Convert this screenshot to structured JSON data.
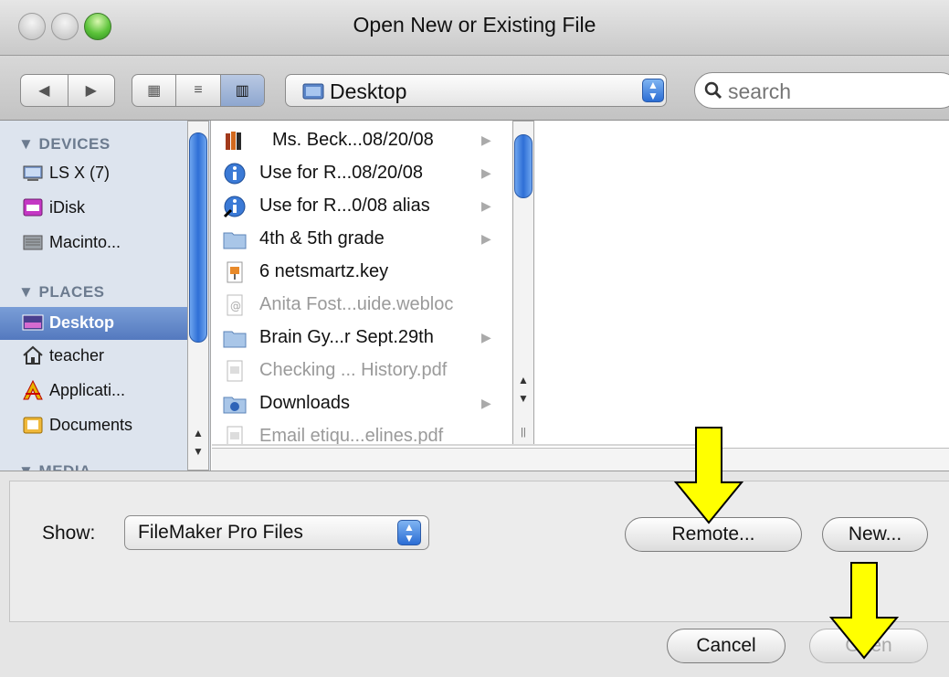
{
  "window": {
    "title": "Open New or Existing File"
  },
  "toolbar": {
    "location": "Desktop",
    "search_placeholder": "search",
    "view_icons": "list-grid-icon"
  },
  "sidebar": {
    "devices_header": "▼ DEVICES",
    "devices": [
      {
        "label": "LS X (7)",
        "icon": "display-icon"
      },
      {
        "label": "iDisk",
        "icon": "idisk-icon"
      },
      {
        "label": "Macinto...",
        "icon": "hard-drive-icon"
      }
    ],
    "places_header": "▼ PLACES",
    "places": [
      {
        "label": "Desktop",
        "icon": "desktop-icon",
        "selected": true
      },
      {
        "label": "teacher",
        "icon": "home-icon"
      },
      {
        "label": "Applicati...",
        "icon": "applications-icon"
      },
      {
        "label": "Documents",
        "icon": "documents-icon"
      }
    ],
    "media_header": "▼ MEDIA"
  },
  "files": [
    {
      "name": "Ms. Beck...08/20/08",
      "icon": "book-icon",
      "dim": false,
      "arrow": true
    },
    {
      "name": "Use for R...08/20/08",
      "icon": "info-icon",
      "dim": false,
      "arrow": true
    },
    {
      "name": "Use for R...0/08 alias",
      "icon": "info-alias-icon",
      "dim": false,
      "arrow": true
    },
    {
      "name": "4th & 5th grade",
      "icon": "folder-icon",
      "dim": false,
      "arrow": true
    },
    {
      "name": "6 netsmartz.key",
      "icon": "keynote-icon",
      "dim": false,
      "arrow": false
    },
    {
      "name": "Anita Fost...uide.webloc",
      "icon": "webloc-icon",
      "dim": true,
      "arrow": false
    },
    {
      "name": "Brain Gy...r Sept.29th",
      "icon": "folder-icon",
      "dim": false,
      "arrow": true
    },
    {
      "name": "Checking ... History.pdf",
      "icon": "pdf-icon",
      "dim": true,
      "arrow": false
    },
    {
      "name": "Downloads",
      "icon": "downloads-folder-icon",
      "dim": false,
      "arrow": true
    },
    {
      "name": "Email etiqu...elines.pdf",
      "icon": "pdf-icon",
      "dim": true,
      "arrow": false
    }
  ],
  "bottom": {
    "show_label": "Show:",
    "show_value": "FileMaker Pro Files",
    "remote_label": "Remote...",
    "new_label": "New...",
    "cancel_label": "Cancel",
    "open_label": "Open"
  },
  "colors": {
    "selection": "#5479bf",
    "arrow_fill": "#ffff00",
    "scroll_thumb": "#2e6fd6"
  }
}
